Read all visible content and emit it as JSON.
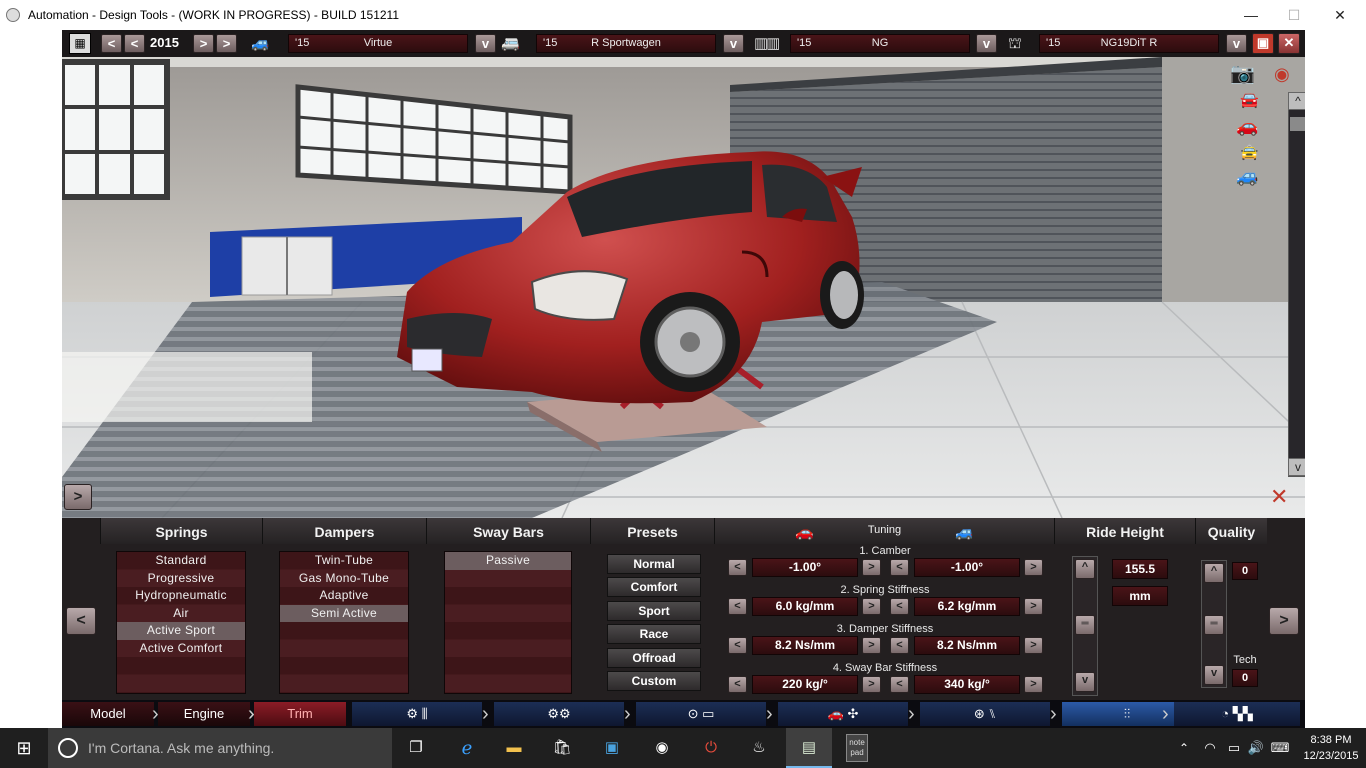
{
  "window": {
    "title": "Automation - Design Tools - (WORK IN PROGRESS) - BUILD 151211",
    "minimize": "—",
    "maximize": "☐",
    "close": "✕"
  },
  "topbar": {
    "year": "2015",
    "prev_far": "<",
    "prev": "<",
    "next": ">",
    "next_far": ">",
    "dropdown": "v",
    "model": {
      "year": "'15",
      "name": "Virtue"
    },
    "trim": {
      "year": "'15",
      "name": "R Sportwagen"
    },
    "engine_family": {
      "year": "'15",
      "name": "NG"
    },
    "engine_variant": {
      "year": "'15",
      "name": "NG19DiT R"
    },
    "close": "✕"
  },
  "viewport": {
    "left_arrow": ">",
    "scroll_up": "^",
    "scroll_down": "v"
  },
  "panel": {
    "headers": {
      "springs": "Springs",
      "dampers": "Dampers",
      "sway_bars": "Sway Bars",
      "presets": "Presets",
      "tuning": "Tuning",
      "ride_height": "Ride Height",
      "quality": "Quality"
    },
    "springs": [
      "Standard",
      "Progressive",
      "Hydropneumatic",
      "Air",
      "Active Sport",
      "Active Comfort"
    ],
    "springs_selected": "Active Sport",
    "dampers": [
      "Twin-Tube",
      "Gas Mono-Tube",
      "Adaptive",
      "Semi Active"
    ],
    "dampers_selected": "Semi Active",
    "sway_bars": [
      "Passive"
    ],
    "sway_selected": "Passive",
    "presets": [
      "Normal",
      "Comfort",
      "Sport",
      "Race",
      "Offroad",
      "Custom"
    ],
    "tuning": [
      {
        "label": "1. Camber",
        "front": "-1.00°",
        "rear": "-1.00°"
      },
      {
        "label": "2. Spring Stiffness",
        "front": "6.0 kg/mm",
        "rear": "6.2 kg/mm"
      },
      {
        "label": "3. Damper Stiffness",
        "front": "8.2 Ns/mm",
        "rear": "8.2 Ns/mm"
      },
      {
        "label": "4. Sway Bar Stiffness",
        "front": "220 kg/°",
        "rear": "340 kg/°"
      }
    ],
    "dec": "<",
    "inc": ">",
    "ride_height": {
      "value": "155.5",
      "unit": "mm",
      "up": "^",
      "down": "v"
    },
    "quality": {
      "value": "0",
      "tech_label": "Tech",
      "tech_value": "0",
      "up": "^",
      "down": "v"
    },
    "page_prev": "<",
    "page_next": ">"
  },
  "nav": {
    "tabs": [
      "Model",
      "Engine",
      "Trim"
    ],
    "active": "Trim"
  },
  "taskbar": {
    "cortana": "I'm Cortana. Ask me anything.",
    "time": "8:38 PM",
    "date": "12/23/2015",
    "notepad_label": "note pad"
  }
}
